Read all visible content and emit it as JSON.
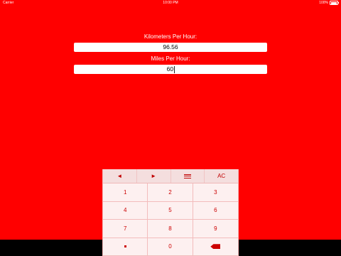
{
  "status": {
    "carrier": "Carrier",
    "time": "10:00 PM",
    "battery": "100%"
  },
  "converter": {
    "kmh_label": "Kilometers Per Hour:",
    "kmh_value": "96.56",
    "mph_label": "Miles Per Hour:",
    "mph_value": "60"
  },
  "keypad": {
    "top_row": {
      "left_label": "◄",
      "right_label": "►",
      "menu_icon": "hamburger-icon",
      "clear_label": "AC"
    },
    "digits": [
      "1",
      "2",
      "3",
      "4",
      "5",
      "6",
      "7",
      "8",
      "9"
    ],
    "zero": "0",
    "decimal_icon": "dot-icon",
    "delete_icon": "backspace-icon"
  },
  "colors": {
    "background": "#ff0000",
    "key_text": "#cc0000",
    "keypad_bg": "#fdf0f0"
  }
}
